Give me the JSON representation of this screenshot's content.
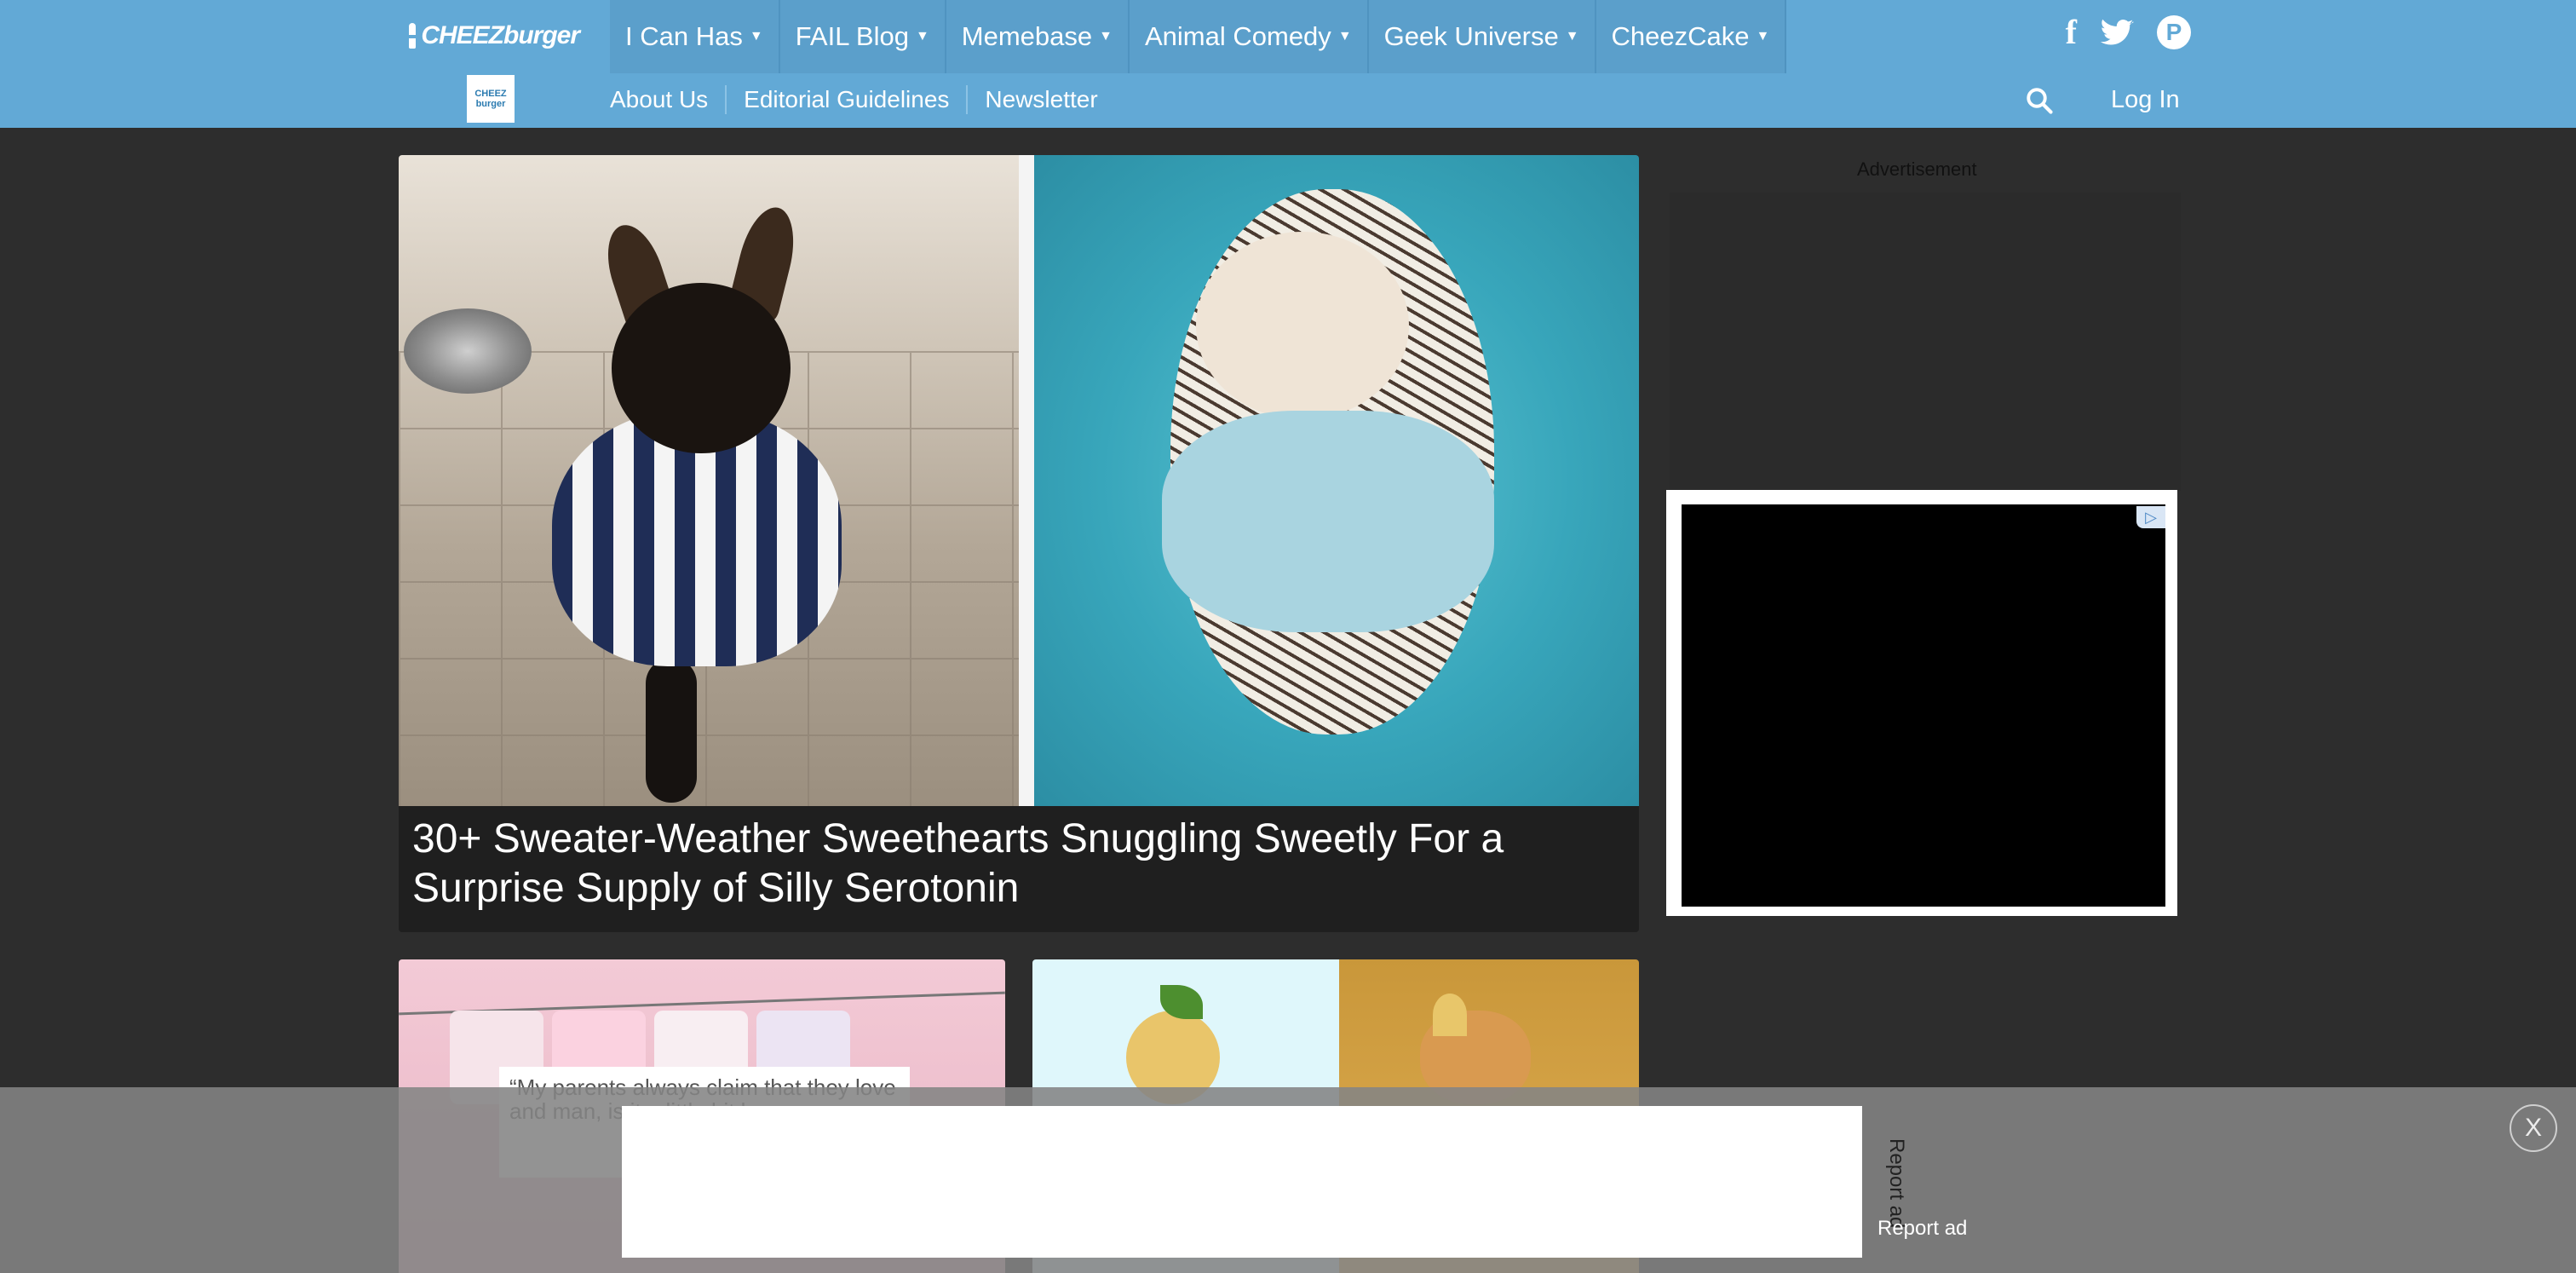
{
  "brand": {
    "logo_text": "CHEEZburger",
    "sub_logo_top": "CHEEZ",
    "sub_logo_bottom": "burger"
  },
  "menu": [
    {
      "label": "I Can Has"
    },
    {
      "label": "FAIL Blog"
    },
    {
      "label": "Memebase"
    },
    {
      "label": "Animal Comedy"
    },
    {
      "label": "Geek Universe"
    },
    {
      "label": "CheezCake"
    }
  ],
  "social": {
    "facebook": "f",
    "twitter": "twitter-icon",
    "pinterest": "P"
  },
  "subnav": [
    {
      "label": "About Us"
    },
    {
      "label": "Editorial Guidelines"
    },
    {
      "label": "Newsletter"
    }
  ],
  "login_label": "Log In",
  "featured": {
    "title": "30+ Sweater-Weather Sweethearts Snuggling Sweetly For a Surprise Supply of Silly Serotonin"
  },
  "card_left": {
    "quote": "“My parents always claim that they love and man, is it o little bit les"
  },
  "sidebar": {
    "ad_label": "Advertisement",
    "ad_choice": "▷"
  },
  "bottom_ad": {
    "report_vertical": "Report ad",
    "report_label": "Report ad",
    "close_label": "X"
  },
  "colors": {
    "nav": "#62a9d6",
    "page_bg": "#2d2d2d"
  }
}
